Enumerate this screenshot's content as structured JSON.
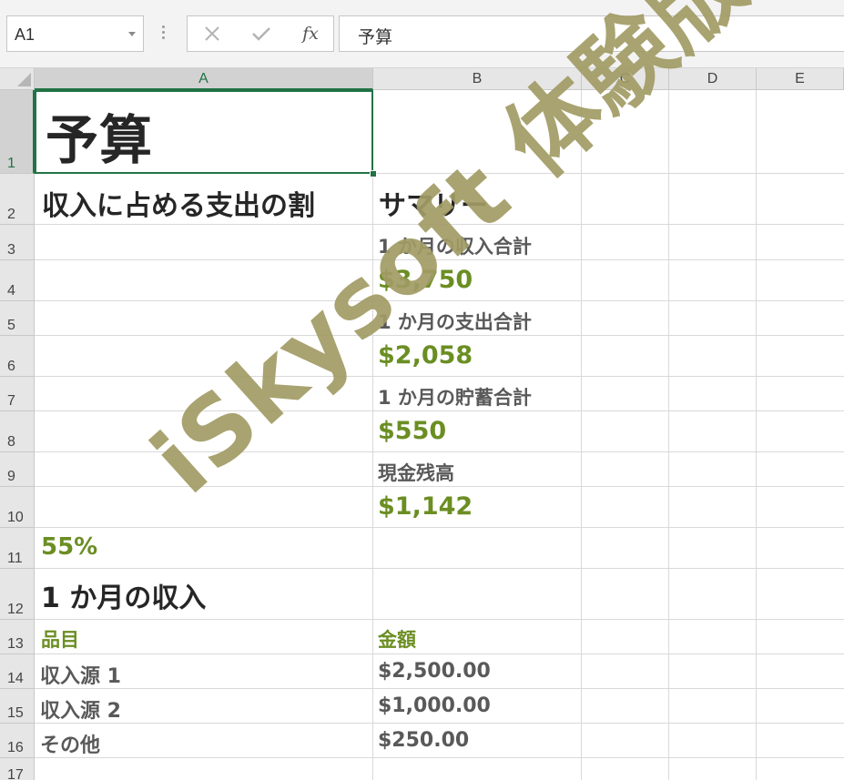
{
  "formula_bar": {
    "name_box": "A1",
    "formula": "予算",
    "fx_label": "fx"
  },
  "columns": [
    "A",
    "B",
    "C",
    "D",
    "E"
  ],
  "rows": [
    "1",
    "2",
    "3",
    "4",
    "5",
    "6",
    "7",
    "8",
    "9",
    "10",
    "11",
    "12",
    "13",
    "14",
    "15",
    "16",
    "17"
  ],
  "sheet": {
    "title": "予算",
    "income_ratio_label": "収入に占める支出の割",
    "summary_title": "サマリー",
    "summary": [
      {
        "label": "1 か月の収入合計",
        "value": "$3,750"
      },
      {
        "label": "1 か月の支出合計",
        "value": "$2,058"
      },
      {
        "label": "1 か月の貯蓄合計",
        "value": "$550"
      },
      {
        "label": "現金残高",
        "value": "$1,142"
      }
    ],
    "percent": "55%",
    "income_title": "1 か月の収入",
    "table_headers": {
      "item": "品目",
      "amount": "金額"
    },
    "income_rows": [
      {
        "item": "収入源 1",
        "amount": "$2,500.00"
      },
      {
        "item": "収入源 2",
        "amount": "$1,000.00"
      },
      {
        "item": "その他",
        "amount": "$250.00"
      }
    ]
  },
  "watermark": "iSkysoft 体験版",
  "colors": {
    "accent_green": "#6b8e23",
    "text_dark": "#262626",
    "text_gray": "#595959",
    "selection_green": "#217346",
    "watermark": "#a19c64"
  }
}
